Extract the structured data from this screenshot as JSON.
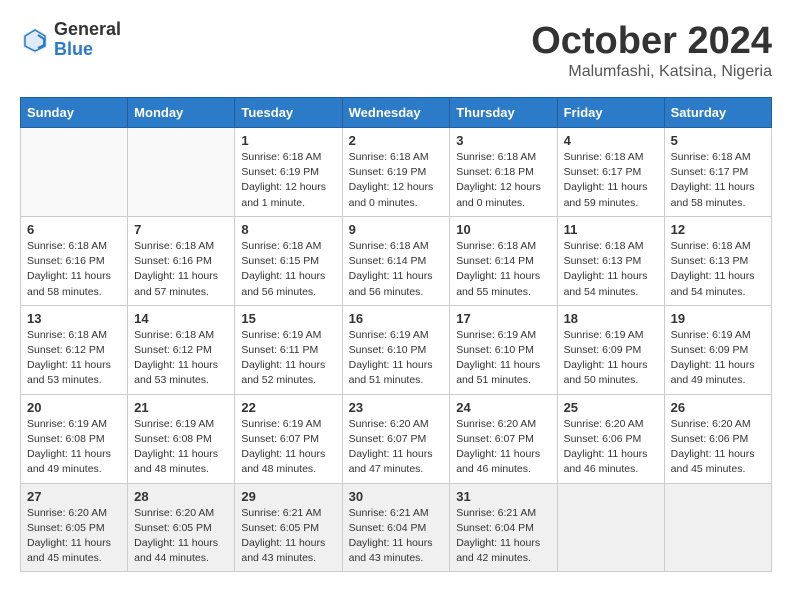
{
  "header": {
    "logo_general": "General",
    "logo_blue": "Blue",
    "month": "October 2024",
    "location": "Malumfashi, Katsina, Nigeria"
  },
  "days_of_week": [
    "Sunday",
    "Monday",
    "Tuesday",
    "Wednesday",
    "Thursday",
    "Friday",
    "Saturday"
  ],
  "weeks": [
    [
      {
        "day": "",
        "content": ""
      },
      {
        "day": "",
        "content": ""
      },
      {
        "day": "1",
        "content": "Sunrise: 6:18 AM\nSunset: 6:19 PM\nDaylight: 12 hours\nand 1 minute."
      },
      {
        "day": "2",
        "content": "Sunrise: 6:18 AM\nSunset: 6:19 PM\nDaylight: 12 hours\nand 0 minutes."
      },
      {
        "day": "3",
        "content": "Sunrise: 6:18 AM\nSunset: 6:18 PM\nDaylight: 12 hours\nand 0 minutes."
      },
      {
        "day": "4",
        "content": "Sunrise: 6:18 AM\nSunset: 6:17 PM\nDaylight: 11 hours\nand 59 minutes."
      },
      {
        "day": "5",
        "content": "Sunrise: 6:18 AM\nSunset: 6:17 PM\nDaylight: 11 hours\nand 58 minutes."
      }
    ],
    [
      {
        "day": "6",
        "content": "Sunrise: 6:18 AM\nSunset: 6:16 PM\nDaylight: 11 hours\nand 58 minutes."
      },
      {
        "day": "7",
        "content": "Sunrise: 6:18 AM\nSunset: 6:16 PM\nDaylight: 11 hours\nand 57 minutes."
      },
      {
        "day": "8",
        "content": "Sunrise: 6:18 AM\nSunset: 6:15 PM\nDaylight: 11 hours\nand 56 minutes."
      },
      {
        "day": "9",
        "content": "Sunrise: 6:18 AM\nSunset: 6:14 PM\nDaylight: 11 hours\nand 56 minutes."
      },
      {
        "day": "10",
        "content": "Sunrise: 6:18 AM\nSunset: 6:14 PM\nDaylight: 11 hours\nand 55 minutes."
      },
      {
        "day": "11",
        "content": "Sunrise: 6:18 AM\nSunset: 6:13 PM\nDaylight: 11 hours\nand 54 minutes."
      },
      {
        "day": "12",
        "content": "Sunrise: 6:18 AM\nSunset: 6:13 PM\nDaylight: 11 hours\nand 54 minutes."
      }
    ],
    [
      {
        "day": "13",
        "content": "Sunrise: 6:18 AM\nSunset: 6:12 PM\nDaylight: 11 hours\nand 53 minutes."
      },
      {
        "day": "14",
        "content": "Sunrise: 6:18 AM\nSunset: 6:12 PM\nDaylight: 11 hours\nand 53 minutes."
      },
      {
        "day": "15",
        "content": "Sunrise: 6:19 AM\nSunset: 6:11 PM\nDaylight: 11 hours\nand 52 minutes."
      },
      {
        "day": "16",
        "content": "Sunrise: 6:19 AM\nSunset: 6:10 PM\nDaylight: 11 hours\nand 51 minutes."
      },
      {
        "day": "17",
        "content": "Sunrise: 6:19 AM\nSunset: 6:10 PM\nDaylight: 11 hours\nand 51 minutes."
      },
      {
        "day": "18",
        "content": "Sunrise: 6:19 AM\nSunset: 6:09 PM\nDaylight: 11 hours\nand 50 minutes."
      },
      {
        "day": "19",
        "content": "Sunrise: 6:19 AM\nSunset: 6:09 PM\nDaylight: 11 hours\nand 49 minutes."
      }
    ],
    [
      {
        "day": "20",
        "content": "Sunrise: 6:19 AM\nSunset: 6:08 PM\nDaylight: 11 hours\nand 49 minutes."
      },
      {
        "day": "21",
        "content": "Sunrise: 6:19 AM\nSunset: 6:08 PM\nDaylight: 11 hours\nand 48 minutes."
      },
      {
        "day": "22",
        "content": "Sunrise: 6:19 AM\nSunset: 6:07 PM\nDaylight: 11 hours\nand 48 minutes."
      },
      {
        "day": "23",
        "content": "Sunrise: 6:20 AM\nSunset: 6:07 PM\nDaylight: 11 hours\nand 47 minutes."
      },
      {
        "day": "24",
        "content": "Sunrise: 6:20 AM\nSunset: 6:07 PM\nDaylight: 11 hours\nand 46 minutes."
      },
      {
        "day": "25",
        "content": "Sunrise: 6:20 AM\nSunset: 6:06 PM\nDaylight: 11 hours\nand 46 minutes."
      },
      {
        "day": "26",
        "content": "Sunrise: 6:20 AM\nSunset: 6:06 PM\nDaylight: 11 hours\nand 45 minutes."
      }
    ],
    [
      {
        "day": "27",
        "content": "Sunrise: 6:20 AM\nSunset: 6:05 PM\nDaylight: 11 hours\nand 45 minutes."
      },
      {
        "day": "28",
        "content": "Sunrise: 6:20 AM\nSunset: 6:05 PM\nDaylight: 11 hours\nand 44 minutes."
      },
      {
        "day": "29",
        "content": "Sunrise: 6:21 AM\nSunset: 6:05 PM\nDaylight: 11 hours\nand 43 minutes."
      },
      {
        "day": "30",
        "content": "Sunrise: 6:21 AM\nSunset: 6:04 PM\nDaylight: 11 hours\nand 43 minutes."
      },
      {
        "day": "31",
        "content": "Sunrise: 6:21 AM\nSunset: 6:04 PM\nDaylight: 11 hours\nand 42 minutes."
      },
      {
        "day": "",
        "content": ""
      },
      {
        "day": "",
        "content": ""
      }
    ]
  ]
}
